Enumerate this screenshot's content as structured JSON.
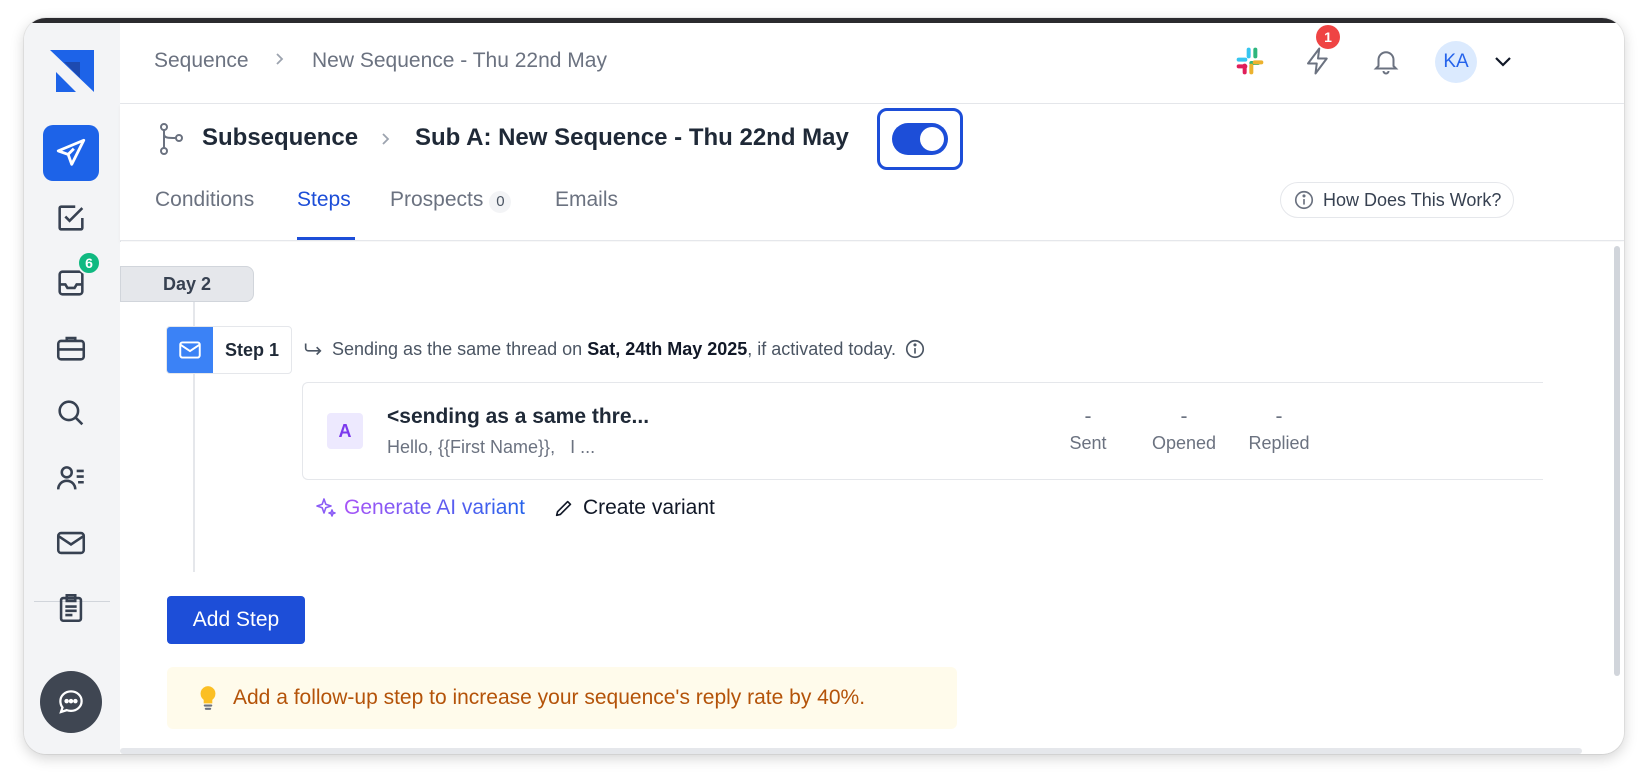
{
  "breadcrumb": {
    "first": "Sequence",
    "second": "New Sequence - Thu 22nd May"
  },
  "topbar": {
    "notification_count": "1",
    "avatar_initials": "KA"
  },
  "sidebar": {
    "inbox_badge": "6"
  },
  "subsequence": {
    "label": "Subsequence",
    "name": "Sub A: New Sequence - Thu 22nd May",
    "toggle_on": true
  },
  "tabs": [
    {
      "label": "Conditions"
    },
    {
      "label": "Steps"
    },
    {
      "label": "Prospects",
      "count": "0"
    },
    {
      "label": "Emails"
    }
  ],
  "help": {
    "label": "How Does This Work?"
  },
  "day": {
    "label": "Day 2"
  },
  "step": {
    "label": "Step 1",
    "info_prefix": "Sending as the same thread on",
    "info_date": "Sat, 24th May 2025",
    "info_suffix": ", if activated today."
  },
  "email": {
    "variant": "A",
    "subject": "<sending as a same thre...",
    "preview": "Hello, {{First Name}},   I ...",
    "stats": [
      {
        "value": "-",
        "label": "Sent"
      },
      {
        "value": "-",
        "label": "Opened"
      },
      {
        "value": "-",
        "label": "Replied"
      }
    ]
  },
  "actions": {
    "generate_ai": "Generate AI variant",
    "create_variant": "Create variant"
  },
  "add_step": "Add Step",
  "tip": "Add a follow-up step to increase your sequence's reply rate by 40%.",
  "colors": {
    "primary": "#1d4ed8",
    "accent_green": "#10b981",
    "alert_red": "#ef4444",
    "tip_bg": "#fffbeb",
    "tip_text": "#b45309"
  }
}
